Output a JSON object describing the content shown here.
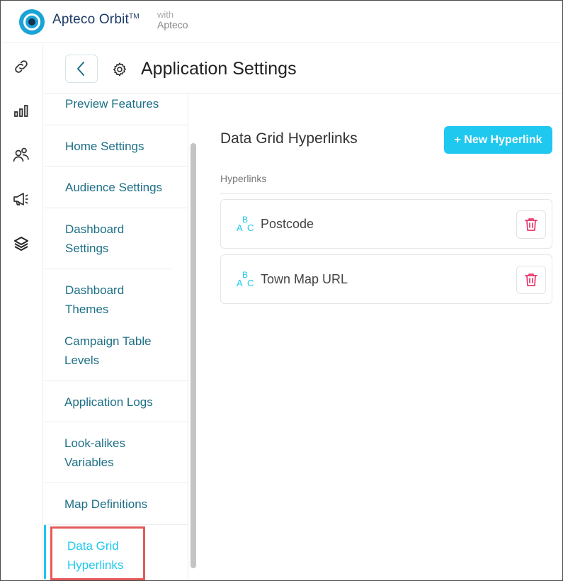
{
  "app": {
    "brand": "Apteco Orbit",
    "trademark": "TM",
    "with_label": "with",
    "with_brand": "Apteco"
  },
  "rail": {
    "icons": [
      "link-icon",
      "bar-chart-icon",
      "people-icon",
      "megaphone-icon",
      "layers-icon"
    ]
  },
  "header": {
    "title": "Application Settings"
  },
  "nav": {
    "items": [
      {
        "label": "Preview Features"
      },
      {
        "label": "Home Settings"
      },
      {
        "label": "Audience Settings"
      },
      {
        "label": "Dashboard Settings"
      },
      {
        "label": "Dashboard Themes"
      },
      {
        "label": "Campaign Table Levels"
      },
      {
        "label": "Application Logs"
      },
      {
        "label": "Look-alikes Variables"
      },
      {
        "label": "Map Definitions"
      },
      {
        "label": "Data Grid Hyperlinks",
        "active": true
      }
    ]
  },
  "main": {
    "title": "Data Grid Hyperlinks",
    "new_button": "+ New Hyperlink",
    "list_label": "Hyperlinks",
    "hyperlinks": [
      {
        "label": "Postcode"
      },
      {
        "label": "Town Map URL"
      }
    ]
  },
  "colors": {
    "accent": "#1ec8ee",
    "nav_text": "#1d6f86",
    "delete": "#e8356b",
    "highlight": "#e35a5a"
  }
}
